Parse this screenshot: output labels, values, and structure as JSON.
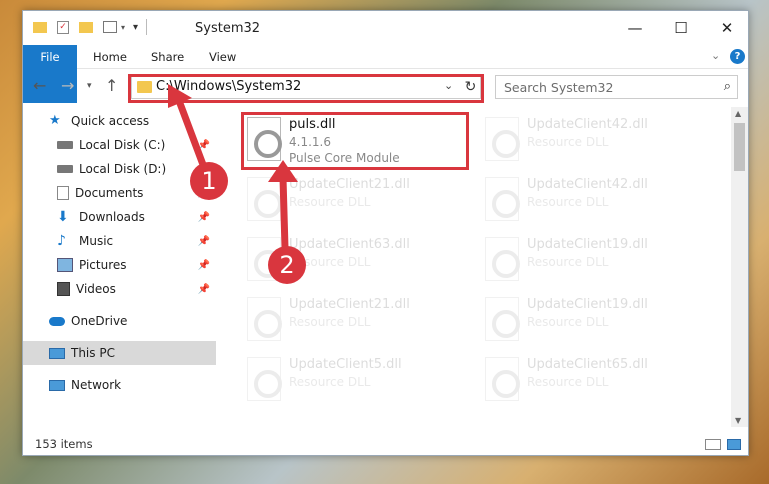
{
  "window": {
    "title": "System32",
    "minimize": "—",
    "maximize": "☐",
    "close": "✕"
  },
  "ribbon": {
    "tabs": [
      "File",
      "Home",
      "Share",
      "View"
    ],
    "help": "?"
  },
  "address": {
    "path": "C:\\Windows\\System32",
    "search_placeholder": "Search System32"
  },
  "sidebar": {
    "items": [
      {
        "label": "Quick access",
        "icon": "star-icon"
      },
      {
        "label": "Local Disk (C:)",
        "icon": "drive-icon"
      },
      {
        "label": "Local Disk (D:)",
        "icon": "drive-icon"
      },
      {
        "label": "Documents",
        "icon": "documents-icon"
      },
      {
        "label": "Downloads",
        "icon": "download-icon"
      },
      {
        "label": "Music",
        "icon": "music-icon"
      },
      {
        "label": "Pictures",
        "icon": "pictures-icon"
      },
      {
        "label": "Videos",
        "icon": "videos-icon"
      },
      {
        "label": "OneDrive",
        "icon": "cloud-icon"
      },
      {
        "label": "This PC",
        "icon": "pc-icon"
      },
      {
        "label": "Network",
        "icon": "network-icon"
      }
    ]
  },
  "files": [
    {
      "name": "puls.dll",
      "line1": "4.1.1.6",
      "line2": "Pulse Core Module"
    },
    {
      "name": "UpdateClient42.dll",
      "line1": "Resource DLL"
    },
    {
      "name": "UpdateClient21.dll",
      "line1": "Resource DLL"
    },
    {
      "name": "UpdateClient42.dll",
      "line1": "Resource DLL"
    },
    {
      "name": "UpdateClient63.dll",
      "line1": "Resource DLL"
    },
    {
      "name": "UpdateClient19.dll",
      "line1": "Resource DLL"
    },
    {
      "name": "UpdateClient21.dll",
      "line1": "Resource DLL"
    },
    {
      "name": "UpdateClient19.dll",
      "line1": "Resource DLL"
    },
    {
      "name": "UpdateClient5.dll",
      "line1": "Resource DLL"
    },
    {
      "name": "UpdateClient65.dll",
      "line1": "Resource DLL"
    }
  ],
  "status": {
    "count": "153 items"
  },
  "callouts": [
    "1",
    "2"
  ],
  "colors": {
    "accent": "#1979ca",
    "highlight": "#d9363e"
  }
}
